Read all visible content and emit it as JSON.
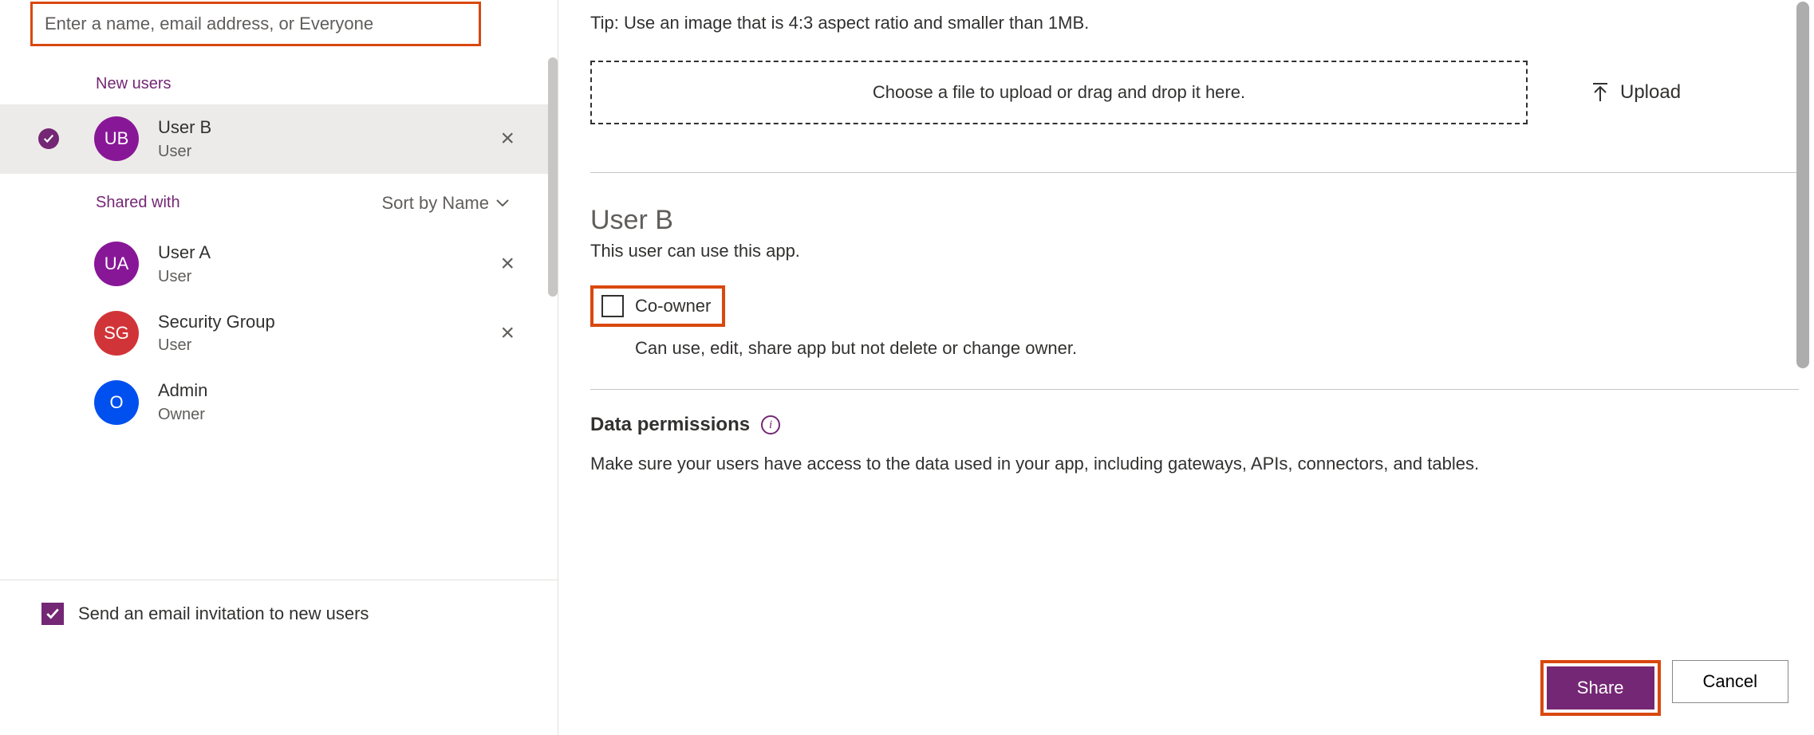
{
  "search": {
    "placeholder": "Enter a name, email address, or Everyone"
  },
  "sections": {
    "new_users": "New users",
    "shared_with": "Shared with",
    "sort_by": "Sort by Name"
  },
  "users": {
    "new": [
      {
        "initials": "UB",
        "name": "User B",
        "role": "User",
        "selected": true
      }
    ],
    "shared": [
      {
        "initials": "UA",
        "name": "User A",
        "role": "User",
        "color": "purple",
        "removable": true
      },
      {
        "initials": "SG",
        "name": "Security Group",
        "role": "User",
        "color": "red",
        "removable": true
      },
      {
        "initials": "O",
        "name": "Admin",
        "role": "Owner",
        "color": "blue",
        "removable": false
      }
    ]
  },
  "footer": {
    "send_email_label": "Send an email invitation to new users"
  },
  "right": {
    "tip": "Tip: Use an image that is 4:3 aspect ratio and smaller than 1MB.",
    "dropzone": "Choose a file to upload or drag and drop it here.",
    "upload_label": "Upload",
    "selected_user": "User B",
    "selected_user_desc": "This user can use this app.",
    "coowner_label": "Co-owner",
    "coowner_desc": "Can use, edit, share app but not delete or change owner.",
    "data_permissions_title": "Data permissions",
    "data_permissions_desc": "Make sure your users have access to the data used in your app, including gateways, APIs, connectors, and tables."
  },
  "buttons": {
    "share": "Share",
    "cancel": "Cancel"
  }
}
